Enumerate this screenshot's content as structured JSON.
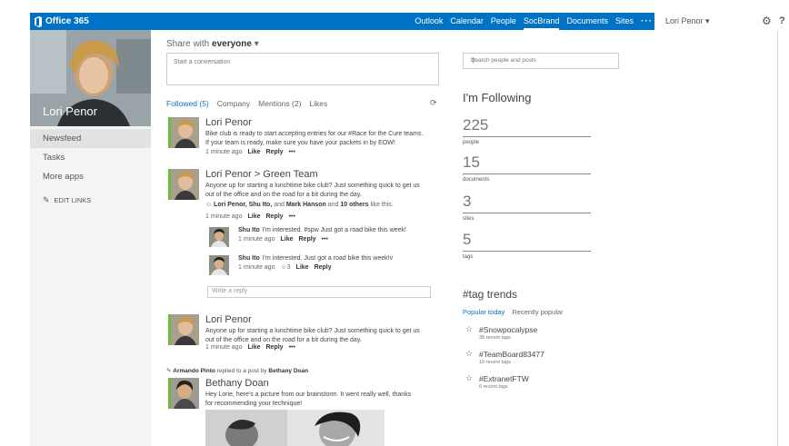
{
  "suite": {
    "brand": "Office 365",
    "nav": [
      "Outlook",
      "Calendar",
      "People",
      "SocBrand",
      "Documents",
      "Sites"
    ],
    "active_nav": "SocBrand",
    "more": "···",
    "user": "Lori Penor ▾",
    "help": "?",
    "colors": {
      "accent": "#0072c6",
      "presence": "#6cbb3c"
    }
  },
  "profile": {
    "name": "Lori Penor"
  },
  "leftnav": {
    "items": [
      "Newsfeed",
      "Tasks",
      "More apps"
    ],
    "edit_links": "EDIT LINKS"
  },
  "share": {
    "prefix": "Share with ",
    "audience": "everyone",
    "caret": " ▾",
    "placeholder": "Start a conversation"
  },
  "feed_tabs": [
    "Followed (5)",
    "Company",
    "Mentions (2)",
    "Likes"
  ],
  "posts": [
    {
      "author": "Lori Penor",
      "body": "Bike club is ready to start accepting entries for our #Race for the Cure teams. If your team is ready, make sure you have your packets in by EOW!",
      "time": "1 minute ago",
      "like": "Like",
      "reply": "Reply",
      "more": "•••"
    },
    {
      "author": "Lori Penor > Green Team",
      "body": "Anyone up for starting a lunchtime bike club? Just something quick to get us out of the office and on the road for a bit during the day.",
      "likes_names": "Lori Penor, Shu Ito,",
      "likes_and": " and ",
      "likes_name3": "Mark Hanson",
      "likes_and2": " and ",
      "likes_others": "10 others",
      "likes_tail": " like this.",
      "time": "1 minute ago",
      "like": "Like",
      "reply": "Reply",
      "more": "•••"
    },
    {
      "author": "Lori Penor",
      "body": "Anyone up for starting a lunchtime bike club? Just something quick to get us out of the office and on the road for a bit during the day.",
      "time": "1 minute ago",
      "like": "Like",
      "reply": "Reply",
      "more": "•••"
    },
    {
      "author": "Bethany Doan",
      "body": "Hey Lorie, here's a picture from our brainstorm. It went really well, thanks for recommending your technique!"
    }
  ],
  "replies": [
    {
      "author": "Shu Ito",
      "text": "I'm interested. #spw Just got a road bike this week!",
      "time": "1 minute ago",
      "like": "Like",
      "reply": "Reply",
      "more": "•••"
    },
    {
      "author": "Shu Ito",
      "text": "I'm interested. Just got a road bike this week!v",
      "time": "1 minute ago",
      "likes_count": "3",
      "like": "Like",
      "reply": "Reply"
    }
  ],
  "write_reply_placeholder": "Write a reply",
  "activity": {
    "actor": "Armando Pinto",
    "text": " replied to a post by ",
    "target": "Bethany Doan"
  },
  "search_placeholder": "Search people and posts",
  "following": {
    "title": "I'm Following",
    "stats": [
      {
        "value": "225",
        "label": "people"
      },
      {
        "value": "15",
        "label": "documents"
      },
      {
        "value": "3",
        "label": "sites"
      },
      {
        "value": "5",
        "label": "tags"
      }
    ]
  },
  "tag_trends": {
    "title": "#tag trends",
    "tabs": [
      "Popular today",
      "Recently popular"
    ],
    "tags": [
      {
        "name": "#Snowpocalypse",
        "count": "38 recent tags"
      },
      {
        "name": "#TeamBoard83477",
        "count": "19 recent tags"
      },
      {
        "name": "#ExtranetFTW",
        "count": "6 recent tags"
      }
    ]
  }
}
